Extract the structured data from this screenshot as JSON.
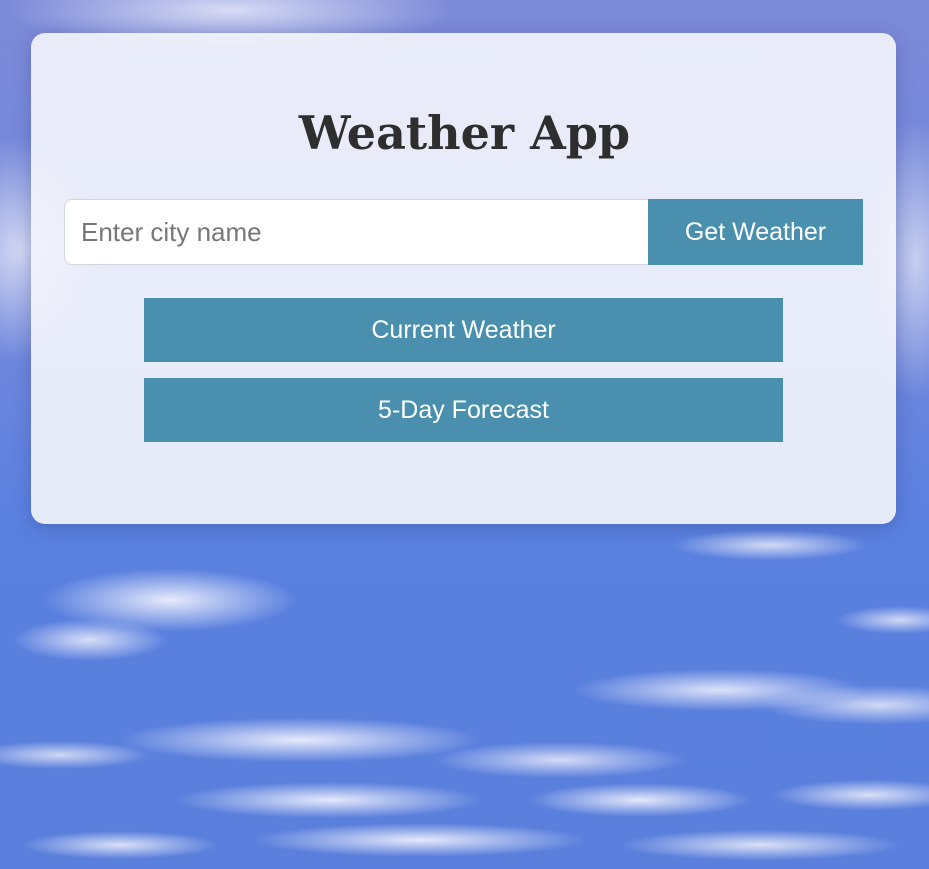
{
  "app": {
    "title": "Weather App"
  },
  "search": {
    "placeholder": "Enter city name",
    "value": "",
    "button_label": "Get Weather"
  },
  "actions": {
    "current_weather_label": "Current Weather",
    "forecast_label": "5-Day Forecast"
  },
  "colors": {
    "button_bg": "#4a90ae",
    "button_text": "#ffffff",
    "title_text": "#2e2e2e",
    "card_bg": "#f5f6fc"
  }
}
